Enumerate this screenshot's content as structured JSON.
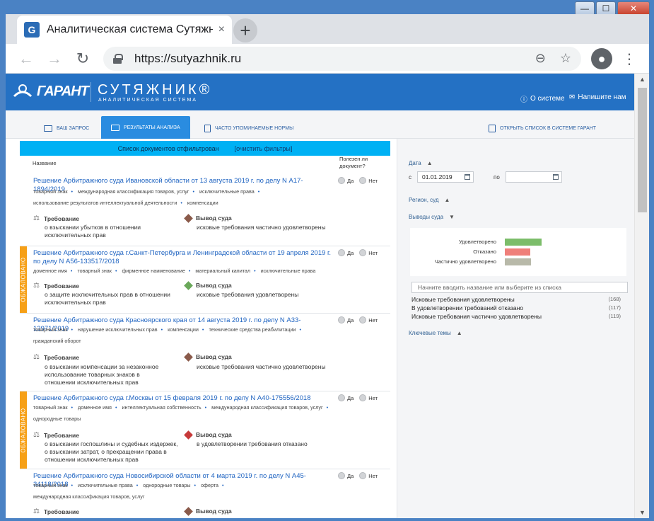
{
  "browser": {
    "tab_title": "Аналитическая система Сутяжник",
    "tab_close": "×",
    "new_tab": "+",
    "url": "https://sutyazhnik.ru",
    "icons": [
      "back-icon",
      "forward-icon",
      "reload-icon",
      "lock-icon",
      "zoom-icon",
      "star-icon",
      "profile-icon",
      "menu-icon"
    ]
  },
  "window": {
    "minimize": "—",
    "maximize": "☐",
    "close": "✕"
  },
  "header": {
    "logo_garant": "ГАРАНТ",
    "logo_sutyazhnik": "СУТЯЖНИК®",
    "logo_subtitle": "АНАЛИТИЧЕСКАЯ СИСТЕМА",
    "about": "О системе",
    "write_us": "Напишите нам",
    "brand_color": "#2471c4"
  },
  "tabs": {
    "query": "ВАШ ЗАПРОС",
    "results": "РЕЗУЛЬТАТЫ АНАЛИЗА",
    "norms": "ЧАСТО УПОМИНАЕМЫЕ НОРМЫ",
    "open_list": "ОТКРЫТЬ СПИСОК В СИСТЕМЕ ГАРАНТ"
  },
  "list": {
    "filter_text": "Список документов отфильтрован",
    "clear_filters": "[очистить фильтры]",
    "col_name": "Название",
    "col_useful": "Полезен ли документ?",
    "yes": "Да",
    "no": "Нет",
    "req_label": "Требование",
    "verdict_label": "Вывод суда",
    "appealed_label": "ОБЖАЛОВАНО",
    "documents": [
      {
        "title": "Решение Арбитражного суда Ивановской области от 13 августа 2019 г. по делу N А17-1894/2019",
        "tags": [
          "товарный знак",
          "международная классификация товаров, услуг",
          "исключительные права",
          "использование результатов интеллектуальной деятельности",
          "компенсации"
        ],
        "requirement": "о взыскании убытков в отношении исключительных прав",
        "verdict": "исковые требования частично удовлетворены",
        "appealed": false
      },
      {
        "title": "Решение Арбитражного суда г.Санкт-Петербурга и Ленинградской области от 19 апреля 2019 г. по делу N А56-133517/2018",
        "tags": [
          "доменное имя",
          "товарный знак",
          "фирменное наименование",
          "материальный капитал",
          "исключительные права"
        ],
        "requirement": "о защите исключительных прав в отношении исключительных прав",
        "verdict": "исковые требования удовлетворены",
        "appealed": true
      },
      {
        "title": "Решение Арбитражного суда Красноярского края от 14 августа 2019 г. по делу N А33-12971/2019",
        "tags": [
          "товарный знак",
          "нарушение исключительных прав",
          "компенсации",
          "технические средства реабилитации",
          "гражданский оборот"
        ],
        "requirement": "о взыскании компенсации за незаконное использование товарных знаков в отношении исключительных прав",
        "verdict": "исковые требования частично удовлетворены",
        "appealed": false
      },
      {
        "title": "Решение Арбитражного суда г.Москвы от 15 февраля 2019 г. по делу N А40-175556/2018",
        "tags": [
          "товарный знак",
          "доменное имя",
          "интеллектуальная собственность",
          "международная классификация товаров, услуг",
          "однородные товары"
        ],
        "requirement": "о взыскании госпошлины и судебных издержек, о взыскании затрат, о прекращении права в отношении исключительных прав",
        "verdict": "в удовлетворении требования отказано",
        "appealed": true
      },
      {
        "title": "Решение Арбитражного суда Новосибирской области от 4 марта 2019 г. по делу N А45-34118/2018",
        "tags": [
          "товарный знак",
          "исключительные права",
          "однородные товары",
          "оферта",
          "международная классификация товаров, услуг"
        ],
        "requirement": "",
        "verdict": "",
        "appealed": false
      }
    ]
  },
  "filters": {
    "date_label": "Дата",
    "date_from_prefix": "с",
    "date_from": "01.01.2019",
    "date_to_prefix": "по",
    "date_to": "",
    "region_label": "Регион, суд",
    "verdicts_label": "Выводы суда",
    "search_placeholder": "Начните вводить название или выберите из списка",
    "keywords_label": "Ключевые темы",
    "chart_bars": [
      {
        "label": "Удовлетворено",
        "color": "#7cbd6a",
        "value": 168
      },
      {
        "label": "Отказано",
        "color": "#ef7f7a",
        "value": 117
      },
      {
        "label": "Частично удовлетворено",
        "color": "#b8b9a9",
        "value": 119
      }
    ],
    "verdict_items": [
      {
        "label": "Исковые требования удовлетворены",
        "count": "(168)"
      },
      {
        "label": "В удовлетворении требований отказано",
        "count": "(117)"
      },
      {
        "label": "Исковые требования частично удовлетворены",
        "count": "(119)"
      }
    ]
  }
}
